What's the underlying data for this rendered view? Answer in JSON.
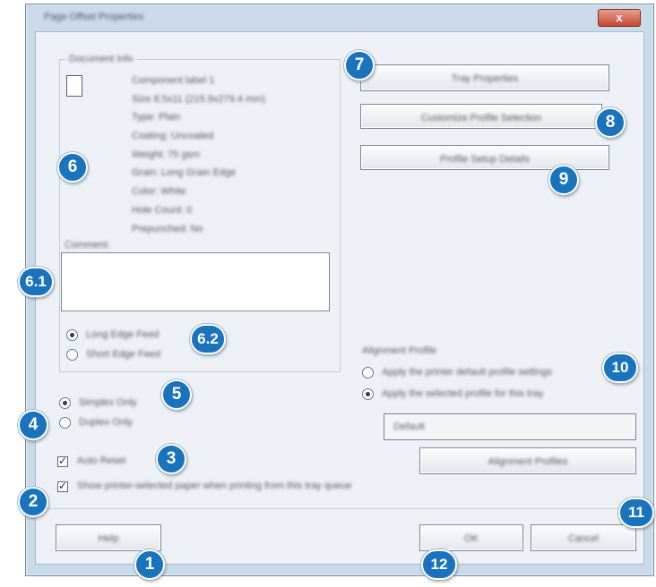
{
  "window": {
    "title": "Page Offset Properties",
    "close_label": "x"
  },
  "properties": {
    "group_label": "Document Info",
    "lines": [
      "Component label 1",
      "Size 8.5x11 (215.9x279.4 mm)",
      "Type: Plain",
      "Coating: Uncoated",
      "Weight: 75 gsm",
      "Grain: Long Grain Edge",
      "Color: White",
      "Hole Count: 0",
      "Prepunched: No"
    ]
  },
  "comment": {
    "label": "Comment:",
    "value": ""
  },
  "radios_inner": [
    {
      "label": "Long Edge Feed",
      "selected": true
    },
    {
      "label": "Short Edge Feed",
      "selected": false
    }
  ],
  "radios_outer": [
    {
      "label": "Simplex Only",
      "selected": true
    },
    {
      "label": "Duplex Only",
      "selected": false
    }
  ],
  "checkboxes": [
    {
      "label": "Auto Reset",
      "checked": true
    },
    {
      "label": "Show printer-selected paper when printing from this tray queue",
      "checked": true
    }
  ],
  "right_buttons": {
    "b7": "Tray Properties",
    "b8": "Customize Profile Selection",
    "b9": "Profile Setup Details"
  },
  "alignment": {
    "group_label": "Alignment Profile",
    "options": [
      {
        "label": "Apply the printer default profile settings",
        "selected": false
      },
      {
        "label": "Apply the selected profile for this tray",
        "selected": true
      }
    ],
    "profile_value": "Default",
    "edit_button": "Alignment Profiles"
  },
  "bottom_buttons": {
    "help": "Help",
    "ok": "OK",
    "cancel": "Cancel"
  },
  "callouts": {
    "c1": "1",
    "c2": "2",
    "c3": "3",
    "c4": "4",
    "c5": "5",
    "c6": "6",
    "c61": "6.1",
    "c62": "6.2",
    "c7": "7",
    "c8": "8",
    "c9": "9",
    "c10": "10",
    "c11": "11",
    "c12": "12"
  },
  "colors": {
    "callout_blue": "#1a73bd",
    "window_frame": "#c9dae8",
    "client_bg": "#edf1f6",
    "close_red": "#c2462f"
  }
}
